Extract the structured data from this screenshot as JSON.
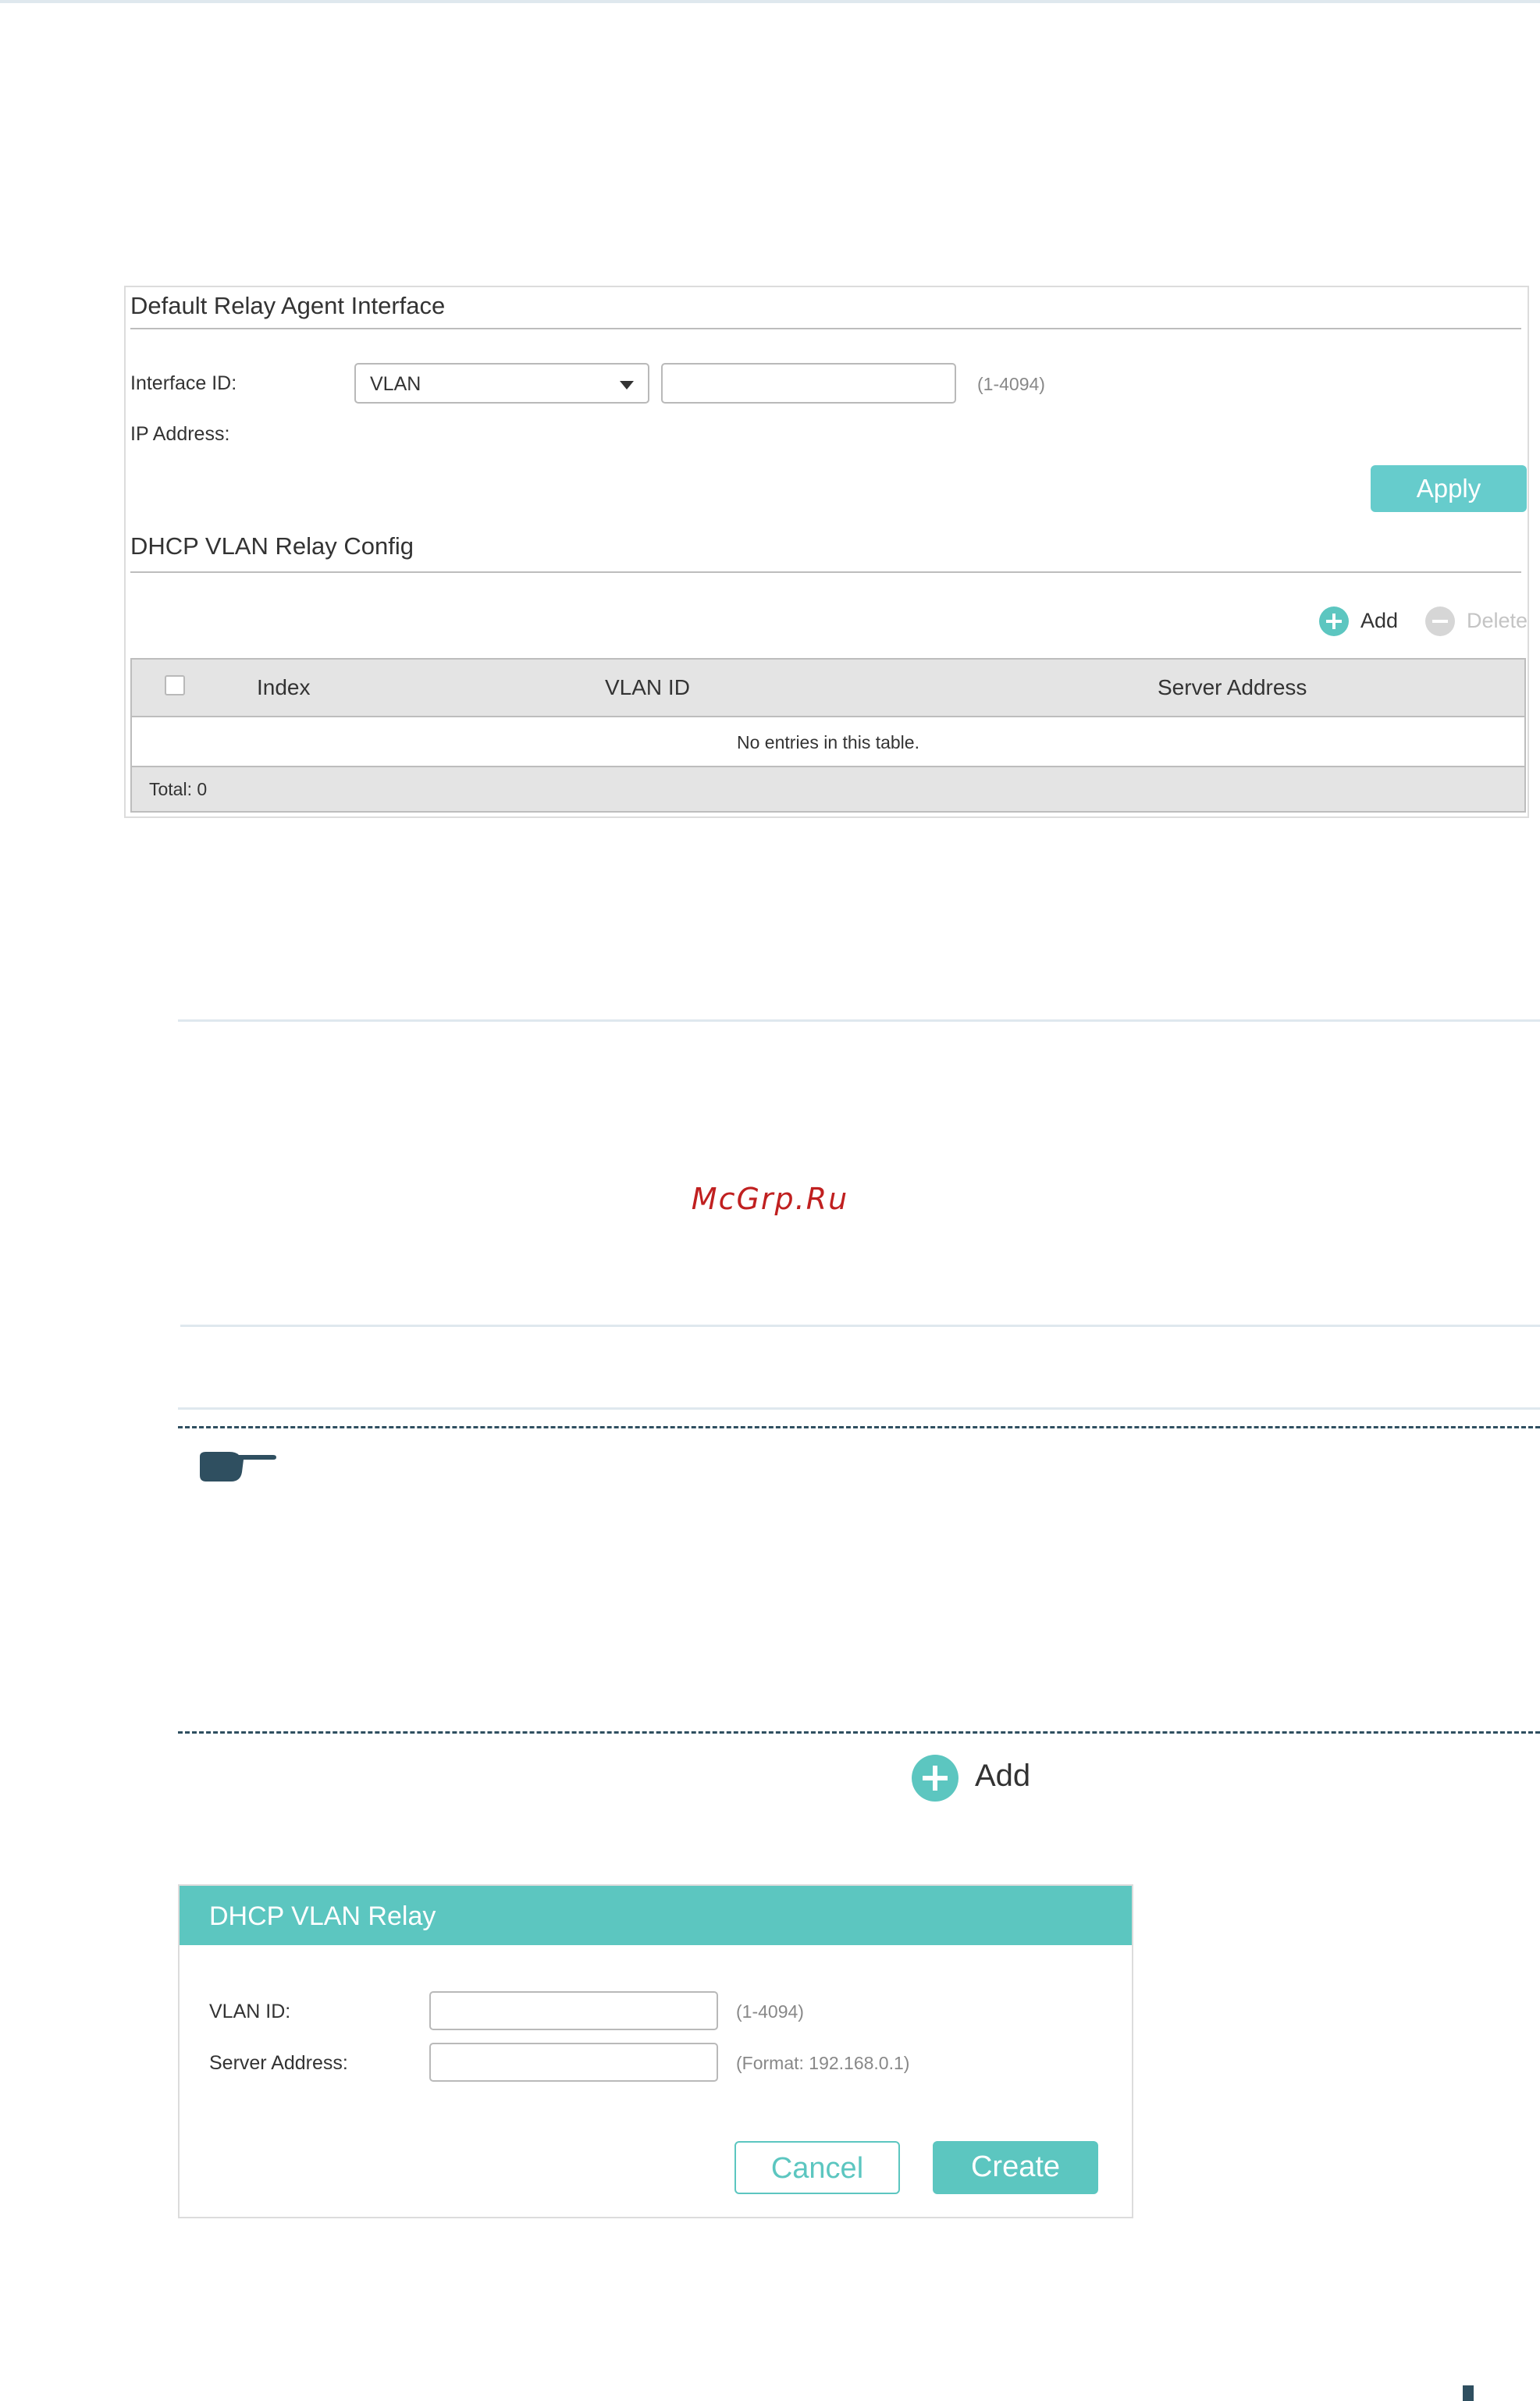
{
  "relay_panel": {
    "default_section_title": "Default Relay Agent Interface",
    "interface_id_label": "Interface ID:",
    "interface_type_value": "VLAN",
    "interface_id_value": "",
    "interface_id_hint": "(1-4094)",
    "ip_address_label": "IP Address:",
    "apply_label": "Apply",
    "vlan_relay_section_title": "DHCP VLAN Relay Config",
    "toolbar": {
      "add_label": "Add",
      "delete_label": "Delete"
    },
    "table": {
      "columns": [
        "Index",
        "VLAN ID",
        "Server Address"
      ],
      "empty_message": "No entries in this table.",
      "total_label": "Total: 0"
    }
  },
  "watermark": "McGrp.Ru",
  "add_button_label": "Add",
  "dialog": {
    "title": "DHCP VLAN Relay",
    "vlan_id_label": "VLAN ID:",
    "vlan_id_value": "",
    "vlan_id_hint": "(1-4094)",
    "server_address_label": "Server Address:",
    "server_address_value": "",
    "server_address_hint": "(Format: 192.168.0.1)",
    "cancel_label": "Cancel",
    "create_label": "Create"
  },
  "colors": {
    "accent": "#5cc6c0",
    "apply": "#66cccc",
    "disabled": "#d6d6d6",
    "watermark": "#c02020",
    "rule": "#dfe8ee",
    "dashed": "#2f4f60"
  }
}
